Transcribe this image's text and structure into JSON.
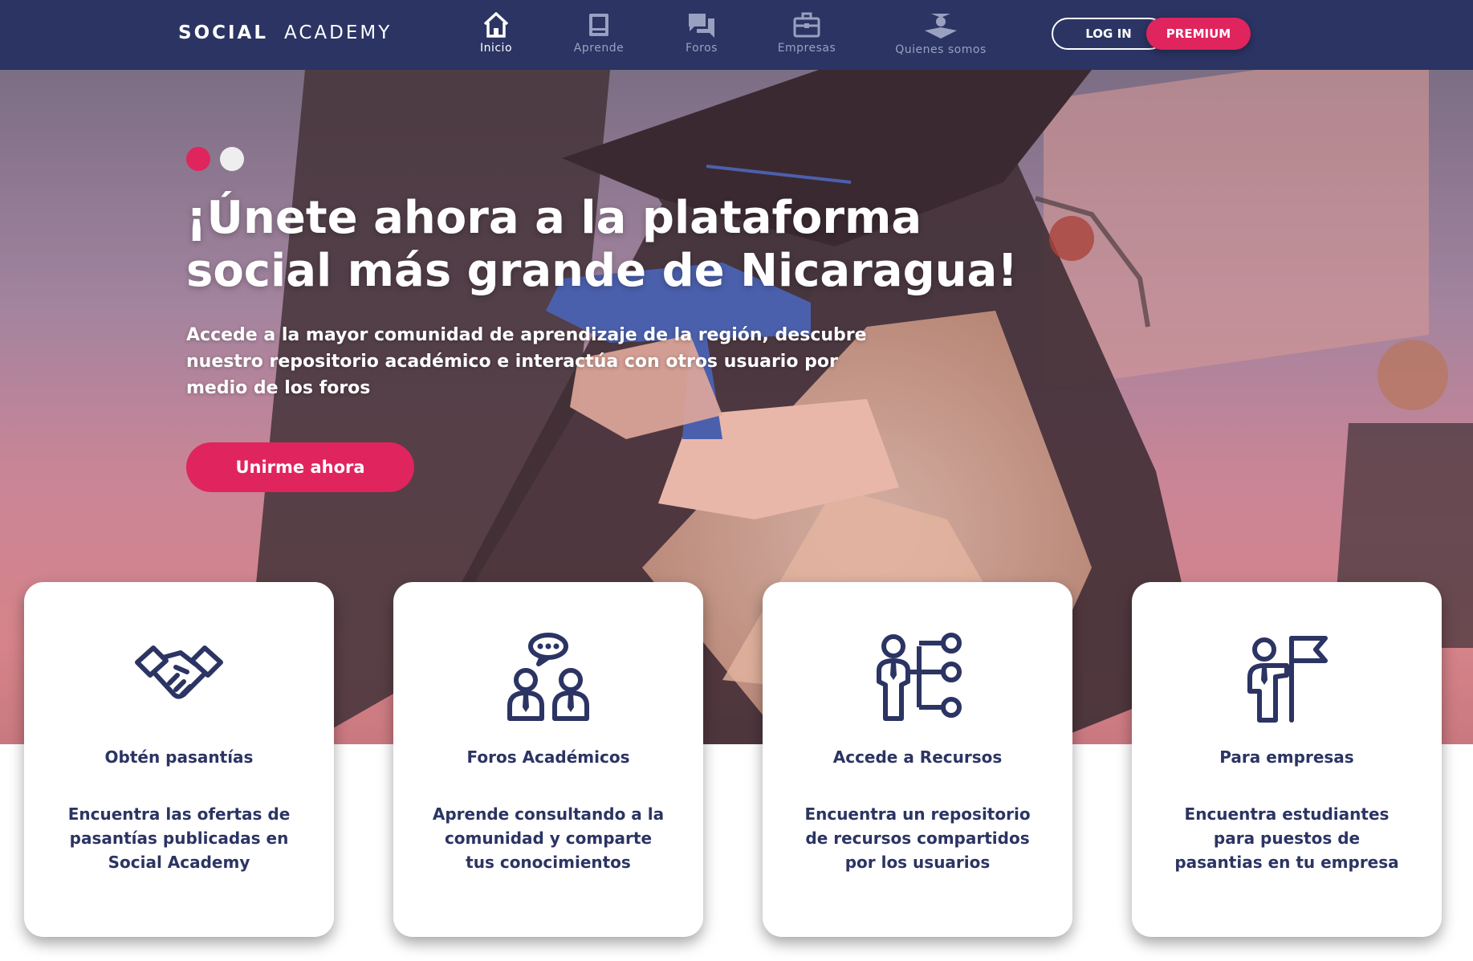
{
  "brand": {
    "part1": "SOCIAL",
    "part2": "ACADEMY"
  },
  "nav": {
    "items": [
      {
        "label": "Inicio",
        "icon": "home-icon",
        "active": true
      },
      {
        "label": "Aprende",
        "icon": "book-icon",
        "active": false
      },
      {
        "label": "Foros",
        "icon": "chat-icon",
        "active": false
      },
      {
        "label": "Empresas",
        "icon": "briefcase-icon",
        "active": false
      },
      {
        "label": "Quienes somos",
        "icon": "graduate-icon",
        "active": false
      }
    ],
    "login_label": "LOG IN",
    "premium_label": "PREMIUM"
  },
  "hero": {
    "title": "¡Únete ahora a la plataforma social más grande de Nicaragua!",
    "subtitle": "Accede a la mayor comunidad de aprendizaje de la región, descubre nuestro repositorio académico e interactúa con otros usuario por medio de los foros",
    "cta_label": "Unirme ahora",
    "slides_total": 2,
    "slide_active": 1
  },
  "cards": [
    {
      "icon": "handshake-icon",
      "title": "Obtén pasantías",
      "text": "Encuentra las ofertas de pasantías publicadas en Social Academy"
    },
    {
      "icon": "people-chat-icon",
      "title": "Foros Académicos",
      "text": "Aprende consultando a la comunidad y comparte tus conocimientos"
    },
    {
      "icon": "person-network-icon",
      "title": "Accede a Recursos",
      "text": "Encuentra un repositorio de recursos compartidos por los usuarios"
    },
    {
      "icon": "person-flag-icon",
      "title": "Para empresas",
      "text": "Encuentra estudiantes para puestos de pasantias en tu empresa"
    }
  ],
  "colors": {
    "navbar": "#2b3463",
    "accent": "#e0245e",
    "card_text": "#2b3463"
  }
}
